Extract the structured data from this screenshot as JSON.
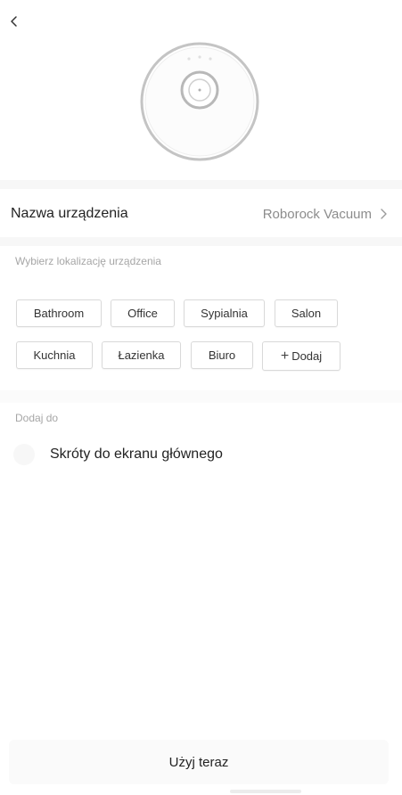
{
  "header": {
    "back_icon": "chevron-left-icon"
  },
  "device": {
    "image_icon": "robot-vacuum-icon",
    "name_label": "Nazwa urządzenia",
    "name_value": "Roborock Vacuum",
    "chevron_icon": "chevron-right-icon"
  },
  "location": {
    "label": "Wybierz lokalizację urządzenia",
    "rooms": [
      "Bathroom",
      "Office",
      "Sypialnia",
      "Salon",
      "Kuchnia",
      "Łazienka",
      "Biuro"
    ],
    "add_label": "Dodaj",
    "add_icon": "plus-icon"
  },
  "add_to": {
    "label": "Dodaj do",
    "shortcut_label": "Skróty do ekranu głównego",
    "shortcut_checked": false
  },
  "footer": {
    "button_label": "Użyj teraz"
  },
  "colors": {
    "background": "#ffffff",
    "divider": "#f7f7f7",
    "muted_text": "#a6a6a6",
    "value_text": "#8c8c8c",
    "chip_border": "#d9d9d9"
  }
}
